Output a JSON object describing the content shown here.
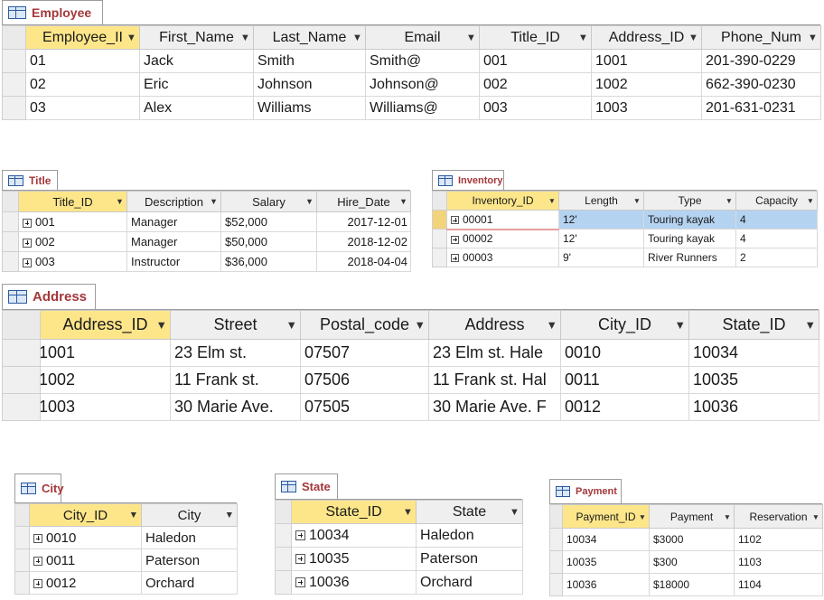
{
  "employee": {
    "title": "Employee",
    "columns": [
      "Employee_II",
      "First_Name",
      "Last_Name",
      "Email",
      "Title_ID",
      "Address_ID",
      "Phone_Num"
    ],
    "rows": [
      [
        "01",
        "Jack",
        "Smith",
        "Smith@",
        "001",
        "1001",
        "201-390-0229"
      ],
      [
        "02",
        "Eric",
        "Johnson",
        "Johnson@",
        "002",
        "1002",
        "662-390-0230"
      ],
      [
        "03",
        "Alex",
        "Williams",
        "Williams@",
        "003",
        "1003",
        "201-631-0231"
      ]
    ]
  },
  "title_table": {
    "title": "Title",
    "columns": [
      "Title_ID",
      "Description",
      "Salary",
      "Hire_Date"
    ],
    "rows": [
      [
        "001",
        "Manager",
        "$52,000",
        "2017-12-01"
      ],
      [
        "002",
        "Manager",
        "$50,000",
        "2018-12-02"
      ],
      [
        "003",
        "Instructor",
        "$36,000",
        "2018-04-04"
      ]
    ]
  },
  "inventory": {
    "title": "Inventory",
    "columns": [
      "Inventory_ID",
      "Length",
      "Type",
      "Capacity"
    ],
    "rows": [
      [
        "00001",
        "12'",
        "Touring kayak",
        "4"
      ],
      [
        "00002",
        "12'",
        "Touring kayak",
        "4"
      ],
      [
        "00003",
        "9'",
        "River Runners",
        "2"
      ]
    ]
  },
  "address": {
    "title": "Address",
    "columns": [
      "Address_ID",
      "Street",
      "Postal_code",
      "Address",
      "City_ID",
      "State_ID"
    ],
    "rows": [
      [
        "1001",
        "23 Elm st.",
        "07507",
        "23 Elm st. Hale",
        "0010",
        "10034"
      ],
      [
        "1002",
        "11 Frank st.",
        "07506",
        "11 Frank st. Hal",
        "0011",
        "10035"
      ],
      [
        "1003",
        "30 Marie Ave.",
        "07505",
        "30 Marie Ave. F",
        "0012",
        "10036"
      ]
    ]
  },
  "city": {
    "title": "City",
    "columns": [
      "City_ID",
      "City"
    ],
    "rows": [
      [
        "0010",
        "Haledon"
      ],
      [
        "0011",
        "Paterson"
      ],
      [
        "0012",
        "Orchard"
      ]
    ]
  },
  "state": {
    "title": "State",
    "columns": [
      "State_ID",
      "State"
    ],
    "rows": [
      [
        "10034",
        "Haledon"
      ],
      [
        "10035",
        "Paterson"
      ],
      [
        "10036",
        "Orchard"
      ]
    ]
  },
  "payment": {
    "title": "Payment",
    "columns": [
      "Payment_ID",
      "Payment",
      "Reservation"
    ],
    "rows": [
      [
        "10034",
        "$3000",
        "1102"
      ],
      [
        "10035",
        "$300",
        "1103"
      ],
      [
        "10036",
        "$18000",
        "1104"
      ]
    ]
  },
  "colors": {
    "tab_text": "#a4373a",
    "key_header": "#fde68a",
    "selected_row": "#b4d3f0",
    "header_bg": "#efefef"
  }
}
